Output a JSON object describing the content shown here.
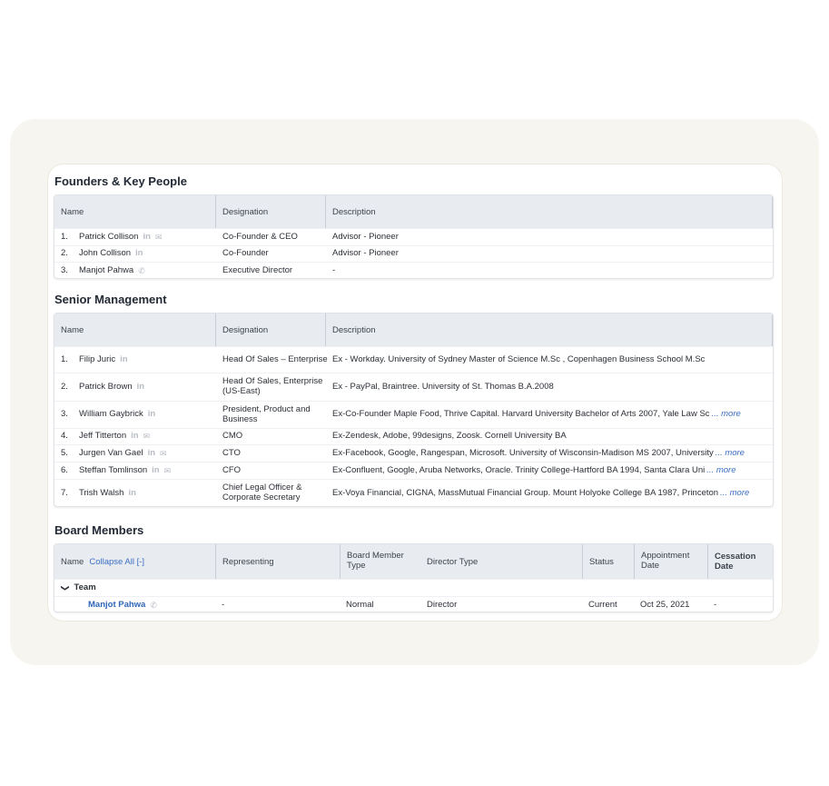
{
  "founders": {
    "title": "Founders & Key People",
    "headers": [
      "Name",
      "Designation",
      "Description"
    ],
    "rows": [
      {
        "num": "1.",
        "name": "Patrick Collison",
        "icons": [
          "linkedin-icon",
          "email-icon"
        ],
        "designation": "Co-Founder & CEO",
        "description": "Advisor - Pioneer",
        "more": ""
      },
      {
        "num": "2.",
        "name": "John Collison",
        "icons": [
          "linkedin-icon"
        ],
        "designation": "Co-Founder",
        "description": "Advisor - Pioneer",
        "more": ""
      },
      {
        "num": "3.",
        "name": "Manjot Pahwa",
        "icons": [
          "phone-icon"
        ],
        "designation": "Executive Director",
        "description": "-",
        "more": ""
      }
    ]
  },
  "senior": {
    "title": "Senior Management",
    "headers": [
      "Name",
      "Designation",
      "Description"
    ],
    "rows": [
      {
        "num": "1.",
        "name": "Filip Juric",
        "icons": [
          "linkedin-icon"
        ],
        "designation": "Head Of Sales – Enterprise",
        "description": "Ex - Workday. University of Sydney Master of Science M.Sc , Copenhagen Business School M.Sc",
        "more": ""
      },
      {
        "num": "2.",
        "name": "Patrick Brown",
        "icons": [
          "linkedin-icon"
        ],
        "designation": "Head Of Sales, Enterprise (US-East)",
        "description": "Ex - PayPal, Braintree. University of St. Thomas B.A.2008",
        "more": ""
      },
      {
        "num": "3.",
        "name": "William Gaybrick",
        "icons": [
          "linkedin-icon"
        ],
        "designation": "President, Product and Business",
        "description": "Ex-Co-Founder Maple Food, Thrive Capital. Harvard University Bachelor of Arts 2007, Yale Law Sc",
        "more": "... more"
      },
      {
        "num": "4.",
        "name": "Jeff Titterton",
        "icons": [
          "linkedin-icon",
          "email-icon"
        ],
        "designation": "CMO",
        "description": "Ex-Zendesk, Adobe, 99designs, Zoosk. Cornell University BA",
        "more": ""
      },
      {
        "num": "5.",
        "name": "Jurgen Van Gael",
        "icons": [
          "linkedin-icon",
          "email-icon"
        ],
        "designation": "CTO",
        "description": "Ex-Facebook, Google, Rangespan, Microsoft. University of Wisconsin-Madison MS 2007, University",
        "more": "... more"
      },
      {
        "num": "6.",
        "name": "Steffan Tomlinson",
        "icons": [
          "linkedin-icon",
          "email-icon"
        ],
        "designation": "CFO",
        "description": "Ex-Confluent, Google, Aruba Networks, Oracle. Trinity College-Hartford BA 1994, Santa Clara Uni",
        "more": "... more"
      },
      {
        "num": "7.",
        "name": "Trish Walsh",
        "icons": [
          "linkedin-icon"
        ],
        "designation": "Chief Legal Officer & Corporate Secretary",
        "description": "Ex-Voya Financial, CIGNA, MassMutual Financial Group. Mount Holyoke College BA 1987, Princeton",
        "more": "... more"
      }
    ]
  },
  "board": {
    "title": "Board Members",
    "headers": {
      "name": "Name",
      "collapse": "Collapse All [-]",
      "representing": "Representing",
      "board_member_type": "Board Member Type",
      "director_type": "Director Type",
      "status": "Status",
      "appointment_date": "Appointment Date",
      "cessation_date": "Cessation Date"
    },
    "group": {
      "toggle": "❯",
      "label": "Team"
    },
    "member": {
      "name": "Manjot Pahwa",
      "icon": "phone-icon",
      "representing": "-",
      "board_member_type": "Normal",
      "director_type": "Director",
      "status": "Current",
      "appointment_date": "Oct 25, 2021",
      "cessation_date": "-"
    }
  }
}
